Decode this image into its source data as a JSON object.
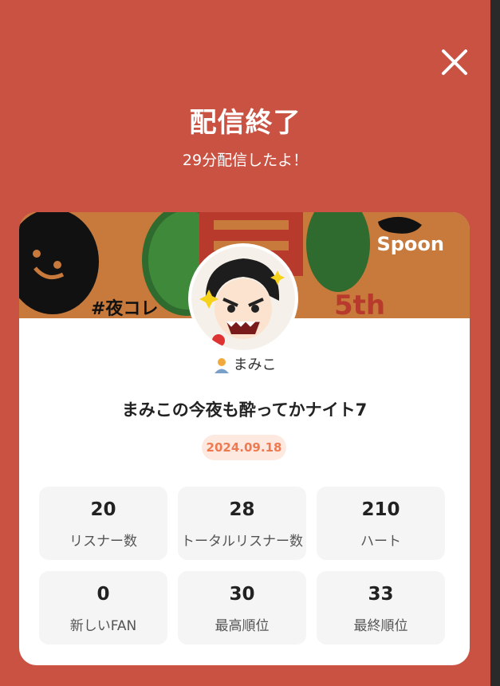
{
  "header": {
    "title": "配信終了",
    "subtitle": "29分配信したよ！"
  },
  "card": {
    "banner_logo": "Spoon",
    "user": {
      "name": "まみこ"
    },
    "live_title": "まみこの今夜も酔ってかナイト7",
    "date": "2024.09.18",
    "stats": [
      {
        "value": "20",
        "label": "リスナー数"
      },
      {
        "value": "28",
        "label": "トータルリスナー数"
      },
      {
        "value": "210",
        "label": "ハート"
      },
      {
        "value": "0",
        "label": "新しいFAN"
      },
      {
        "value": "30",
        "label": "最高順位"
      },
      {
        "value": "33",
        "label": "最終順位"
      }
    ]
  },
  "colors": {
    "background": "#c95243",
    "date_accent": "#ee7a52",
    "date_bg": "#fde9e0"
  }
}
